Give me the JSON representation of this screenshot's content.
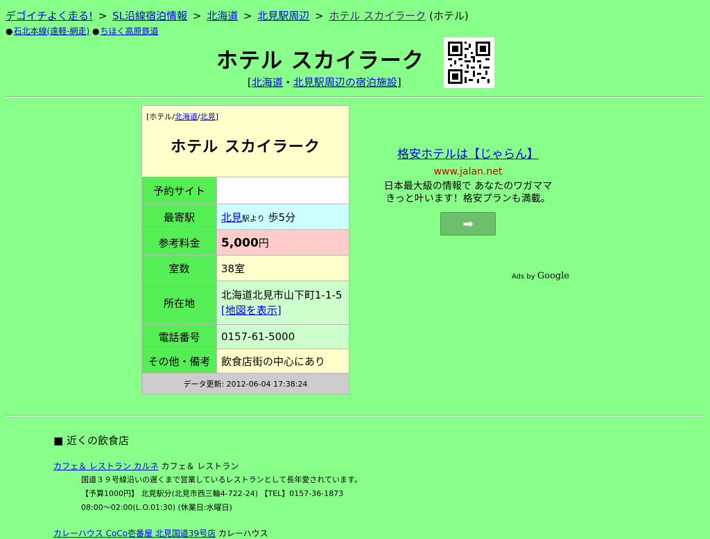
{
  "breadcrumb": {
    "b1": "デゴイチよく走る!",
    "b2": "SL沿線宿泊情報",
    "b3": "北海道",
    "b4": "北見駅周辺",
    "b5": "ホテル スカイラーク",
    "suffix": "(ホテル)",
    "sep": ">"
  },
  "lines": {
    "bullet": "●",
    "l1": "石北本線(遠軽-網走)",
    "l2": "ちほく高原鉄道"
  },
  "page": {
    "title": "ホテル スカイラーク",
    "sub_open": "[",
    "sub_link1": "北海道",
    "sub_dot": "・",
    "sub_link2": "北見駅周辺の宿泊施設",
    "sub_close": "]"
  },
  "info": {
    "cat_open": "[",
    "cat_text": "ホテル/",
    "cat_link1": "北海道",
    "cat_slash": "/",
    "cat_link2": "北見",
    "cat_close": "]",
    "name": "ホテル スカイラーク",
    "rows": {
      "reserve_label": "予約サイト",
      "station_label": "最寄駅",
      "station_link": "北見",
      "station_from": "駅より",
      "station_walk": " 歩5分",
      "price_label": "参考料金",
      "price_value": "5,000",
      "price_unit": "円",
      "rooms_label": "室数",
      "rooms_value": "38室",
      "address_label": "所在地",
      "address_value": "北海道北見市山下町1-1-5",
      "map_link": "[地図を表示]",
      "tel_label": "電話番号",
      "tel_value": "0157-61-5000",
      "notes_label": "その他・備考",
      "notes_value": "飲食店街の中心にあり"
    },
    "updated": "データ更新: 2012-06-04 17:38:24"
  },
  "ad": {
    "link": "格安ホテルは【じゃらん】",
    "url": "www.jalan.net",
    "desc1": "日本最大級の情報で あなたのワガママ",
    "desc2": "きっと叶います！格安プランも満載。",
    "go_icon": "arrow-right-icon",
    "adsby": "Ads by ",
    "google": "Google"
  },
  "nearby": {
    "heading": "■ 近くの飲食店",
    "shops": [
      {
        "name": "カフェ＆ レストラン カルネ",
        "type": " カフェ＆ レストラン",
        "d1": "国道３９号線沿いの遅くまで営業しているレストランとして長年愛されています。",
        "d2": "【予算1000円】 北見駅分(北見市西三輪4-722-24) 【TEL】0157-36-1873",
        "d3": "08:00～02:00(L.O.01:30) (休業日:水曜日)"
      },
      {
        "name": "カレーハウス CoCo壱番屋 北見国道39号店",
        "type": " カレーハウス"
      }
    ]
  },
  "colors": {
    "background": "#88ff88",
    "label_cell": "#55ee55",
    "head_cell": "#ffffcc"
  }
}
